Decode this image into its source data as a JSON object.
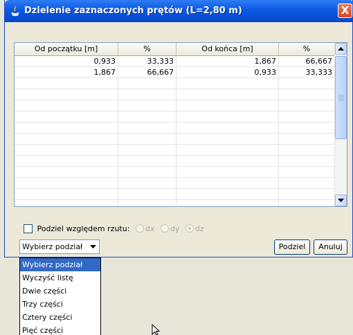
{
  "window": {
    "title": "Dzielenie zaznaczonych prętów (L=2,80 m)",
    "close_glyph": "X"
  },
  "table": {
    "headers": [
      "Od początku [m]",
      "%",
      "Od końca [m]",
      "%"
    ],
    "rows": [
      [
        "0,933",
        "33,333",
        "1,867",
        "66,667"
      ],
      [
        "1,867",
        "66,667",
        "0,933",
        "33,333"
      ]
    ],
    "empty_rows": 12
  },
  "options": {
    "checkbox_label": "Podziel względem rzutu:",
    "checked": false,
    "radios": [
      {
        "label": "dx",
        "selected": false
      },
      {
        "label": "dy",
        "selected": false
      },
      {
        "label": "dz",
        "selected": true
      }
    ]
  },
  "combo": {
    "value": "Wybierz podział"
  },
  "buttons": {
    "divide": "Podziel",
    "cancel": "Anuluj"
  },
  "dropdown": {
    "items": [
      "Wybierz podział",
      "Wyczyść listę",
      "Dwie części",
      "Trzy części",
      "Cztery części",
      "Pięć części"
    ],
    "selected_index": 0
  },
  "colors": {
    "title_bar": "#0a59e2",
    "selection": "#316ac5",
    "close": "#d24b24",
    "desktop": "#e8e6d8"
  }
}
